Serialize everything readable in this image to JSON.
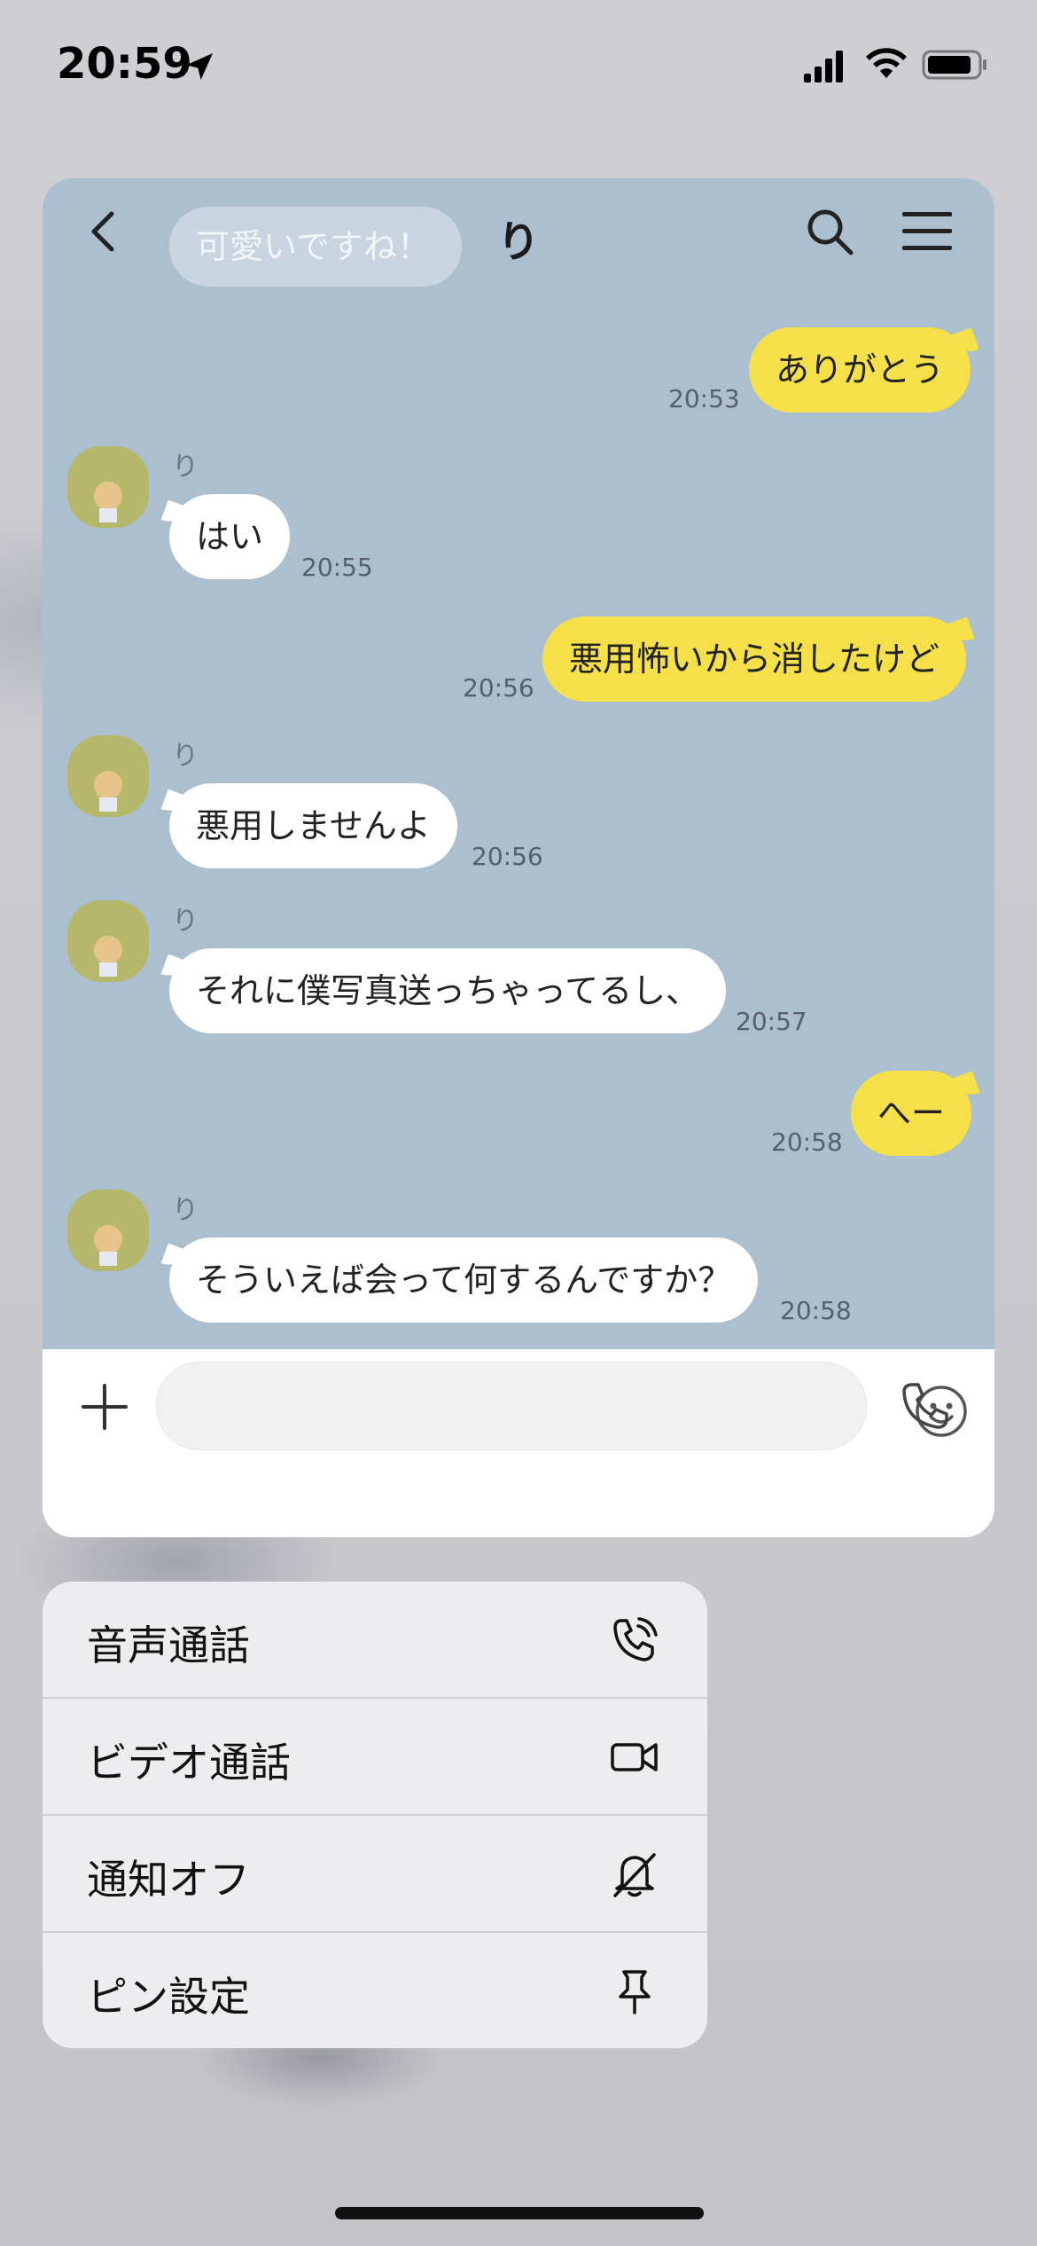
{
  "status_bar": {
    "time": "20:59"
  },
  "chat": {
    "title": "り",
    "ghost_message": "可愛いですね！",
    "messages": [
      {
        "side": "out",
        "text": "ありがとう",
        "time": "20:53"
      },
      {
        "side": "in",
        "name": "り",
        "text": "はい",
        "time": "20:55"
      },
      {
        "side": "out",
        "text": "悪用怖いから消したけど",
        "time": "20:56"
      },
      {
        "side": "in",
        "name": "り",
        "text": "悪用しませんよ",
        "time": "20:56"
      },
      {
        "side": "in",
        "name": "り",
        "text": "それに僕写真送っちゃってるし、",
        "time": "20:57"
      },
      {
        "side": "out",
        "text": "へー",
        "time": "20:58"
      },
      {
        "side": "in",
        "name": "り",
        "text": "そういえば会って何するんですか？",
        "time": "20:58"
      }
    ]
  },
  "input": {
    "placeholder": ""
  },
  "context_menu": {
    "items": [
      {
        "label": "音声通話",
        "icon": "phone-call-icon"
      },
      {
        "label": "ビデオ通話",
        "icon": "video-icon"
      },
      {
        "label": "通知オフ",
        "icon": "bell-off-icon"
      },
      {
        "label": "ピン設定",
        "icon": "pin-icon"
      }
    ]
  },
  "colors": {
    "chat_bg": "#abbfcf",
    "outgoing_bubble": "#f6e049",
    "incoming_bubble": "#ffffff"
  }
}
